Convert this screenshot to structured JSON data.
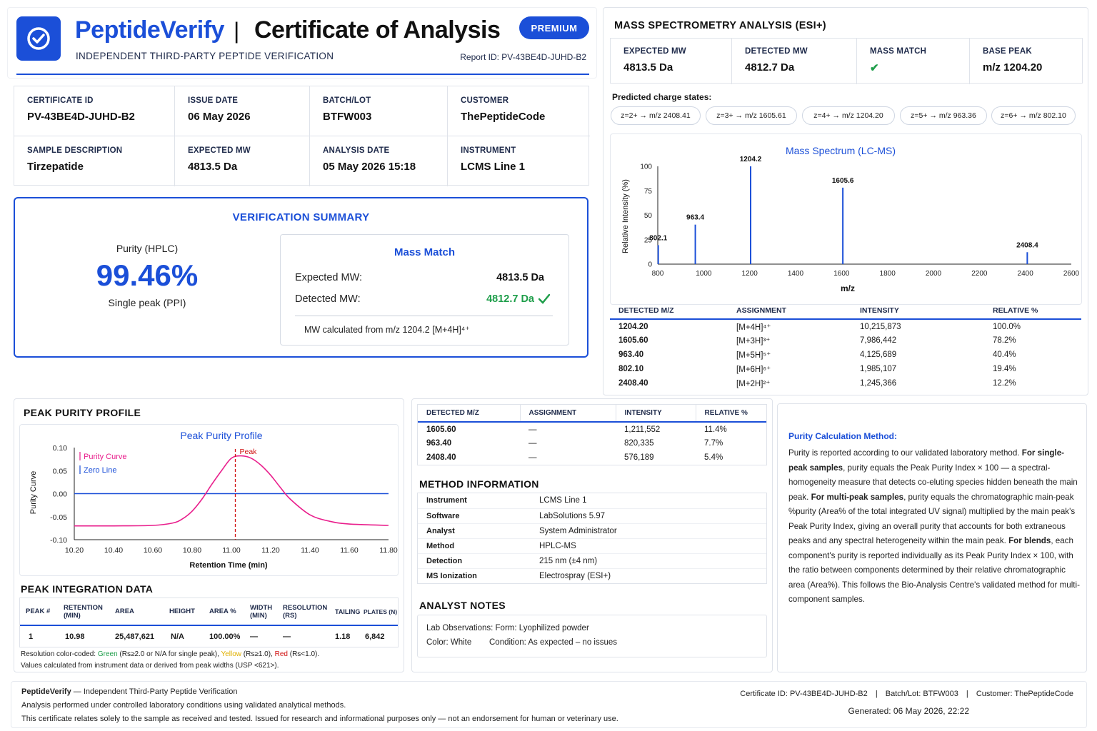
{
  "header": {
    "brand": "PeptideVerify",
    "divider": "|",
    "title": "Certificate of Analysis",
    "subtitle": "INDEPENDENT THIRD-PARTY PEPTIDE VERIFICATION",
    "badge": "PREMIUM",
    "report_id": "Report ID: PV-43BE4D-JUHD-B2"
  },
  "info": [
    {
      "label": "CERTIFICATE ID",
      "value": "PV-43BE4D-JUHD-B2"
    },
    {
      "label": "ISSUE DATE",
      "value": "06 May 2026"
    },
    {
      "label": "BATCH/LOT",
      "value": "BTFW003"
    },
    {
      "label": "CUSTOMER",
      "value": "ThePeptideCode"
    },
    {
      "label": "SAMPLE DESCRIPTION",
      "value": "Tirzepatide"
    },
    {
      "label": "EXPECTED MW",
      "value": "4813.5 Da"
    },
    {
      "label": "ANALYSIS DATE",
      "value": "05 May 2026 15:18"
    },
    {
      "label": "INSTRUMENT",
      "value": "LCMS Line 1"
    }
  ],
  "summary": {
    "title": "VERIFICATION SUMMARY",
    "purity_label": "Purity (HPLC)",
    "purity_value": "99.46%",
    "purity_note": "Single peak (PPI)",
    "mass_match_title": "Mass Match",
    "expected_label": "Expected MW:",
    "expected_value": "4813.5 Da",
    "detected_label": "Detected MW:",
    "detected_value": "4812.7 Da",
    "calc_note": "MW calculated from m/z 1204.2 [M+4H]⁴⁺"
  },
  "ms": {
    "title": "MASS SPECTROMETRY ANALYSIS (ESI+)",
    "stats": [
      {
        "label": "EXPECTED MW",
        "value": "4813.5 Da"
      },
      {
        "label": "DETECTED MW",
        "value": "4812.7 Da"
      },
      {
        "label": "MASS MATCH",
        "value": "✔"
      },
      {
        "label": "BASE PEAK",
        "value": "m/z 1204.20"
      }
    ],
    "charge_label": "Predicted charge states:",
    "charge_states": [
      "z=2+ → m/z 2408.41",
      "z=3+ → m/z 1605.61",
      "z=4+ → m/z 1204.20",
      "z=5+ → m/z 963.36",
      "z=6+ → m/z 802.10"
    ],
    "table_headers": [
      "DETECTED M/Z",
      "ASSIGNMENT",
      "INTENSITY",
      "RELATIVE %"
    ],
    "table_rows": [
      [
        "1204.20",
        "[M+4H]⁴⁺",
        "10,215,873",
        "100.0%"
      ],
      [
        "1605.60",
        "[M+3H]³⁺",
        "7,986,442",
        "78.2%"
      ],
      [
        "963.40",
        "[M+5H]⁵⁺",
        "4,125,689",
        "40.4%"
      ],
      [
        "802.10",
        "[M+6H]⁶⁺",
        "1,985,107",
        "19.4%"
      ],
      [
        "2408.40",
        "[M+2H]²⁺",
        "1,245,366",
        "12.2%"
      ]
    ]
  },
  "chart_data": [
    {
      "type": "bar",
      "title": "Mass Spectrum (LC-MS)",
      "xlabel": "m/z",
      "ylabel": "Relative Intensity (%)",
      "xlim": [
        800,
        2600
      ],
      "ylim": [
        0,
        100
      ],
      "xticks": [
        800,
        1000,
        1200,
        1400,
        1600,
        1800,
        2000,
        2200,
        2400,
        2600
      ],
      "yticks": [
        0,
        25,
        50,
        75,
        100
      ],
      "x": [
        802.1,
        963.4,
        1204.2,
        1605.6,
        2408.4
      ],
      "values": [
        19.4,
        40.4,
        100,
        78.2,
        12.2
      ],
      "labels": [
        "802.1",
        "963.4",
        "1204.2",
        "1605.6",
        "2408.4"
      ],
      "color": "#1b4fd8"
    },
    {
      "type": "line",
      "title": "Peak Purity Profile",
      "xlabel": "Retention Time (min)",
      "ylabel": "Purity Curve",
      "xlim": [
        10.2,
        11.8
      ],
      "ylim": [
        -0.1,
        0.1
      ],
      "xticks": [
        "10.20",
        "10.40",
        "10.60",
        "10.80",
        "11.00",
        "11.20",
        "11.40",
        "11.60",
        "11.80"
      ],
      "yticks": [
        "0.10",
        "0.05",
        "0.00",
        "-0.05",
        "-0.10"
      ],
      "series": [
        {
          "name": "Purity Curve",
          "color": "#e91e8c",
          "x": [
            10.2,
            10.4,
            10.6,
            10.7,
            10.75,
            10.8,
            10.85,
            10.9,
            10.95,
            11.0,
            11.05,
            11.1,
            11.15,
            11.2,
            11.25,
            11.3,
            11.4,
            11.5,
            11.6,
            11.8
          ],
          "y": [
            -0.07,
            -0.07,
            -0.069,
            -0.064,
            -0.055,
            -0.038,
            -0.012,
            0.02,
            0.05,
            0.077,
            0.082,
            0.077,
            0.062,
            0.04,
            0.013,
            -0.012,
            -0.046,
            -0.06,
            -0.066,
            -0.069
          ]
        },
        {
          "name": "Zero Line",
          "color": "#1b4fd8",
          "x": [
            10.2,
            11.8
          ],
          "y": [
            0,
            0
          ]
        }
      ],
      "annotations": [
        {
          "text": "Peak",
          "x": 11.02,
          "color": "#d01010"
        }
      ]
    }
  ],
  "peak_profile": {
    "section_title": "PEAK PURITY PROFILE"
  },
  "integration": {
    "title": "PEAK INTEGRATION DATA",
    "headers": [
      "PEAK #",
      "RETENTION (MIN)",
      "AREA",
      "HEIGHT",
      "AREA %",
      "WIDTH (MIN)",
      "RESOLUTION (RS)",
      "TAILING",
      "PLATES (N)"
    ],
    "row": [
      "1",
      "10.98",
      "25,487,621",
      "N/A",
      "100.00%",
      "—",
      "—",
      "1.18",
      "6,842"
    ],
    "note1_prefix": "Resolution color-coded: ",
    "note1_green": "Green",
    "note1_green_rule": " (Rs≥2.0 or N/A for single peak), ",
    "note1_yellow": "Yellow",
    "note1_yellow_rule": " (Rs≥1.0), ",
    "note1_red": "Red",
    "note1_red_rule": " (Rs<1.0).",
    "note2": "Values calculated from instrument data or derived from peak widths (USP <621>)."
  },
  "extra_table": {
    "headers": [
      "DETECTED M/Z",
      "ASSIGNMENT",
      "INTENSITY",
      "RELATIVE %"
    ],
    "rows": [
      [
        "1605.60",
        "—",
        "1,211,552",
        "11.4%"
      ],
      [
        "963.40",
        "—",
        "820,335",
        "7.7%"
      ],
      [
        "2408.40",
        "—",
        "576,189",
        "5.4%"
      ]
    ]
  },
  "method": {
    "title": "METHOD INFORMATION",
    "rows": [
      [
        "Instrument",
        "LCMS Line 1"
      ],
      [
        "Software",
        "LabSolutions 5.97"
      ],
      [
        "Analyst",
        "System Administrator"
      ],
      [
        "Method",
        "HPLC-MS"
      ],
      [
        "Detection",
        "215 nm (±4 nm)"
      ],
      [
        "MS Ionization",
        "Electrospray (ESI+)"
      ]
    ]
  },
  "notes": {
    "title": "ANALYST NOTES",
    "line1": "Lab Observations: Form: Lyophilized powder",
    "color": "Color: White",
    "condition": "Condition: As expected – no issues"
  },
  "purity_method": {
    "title": "Purity Calculation Method:",
    "p1": "Purity is reported according to our validated laboratory method.",
    "b1": "For single-peak samples",
    "t1": ", purity equals the Peak Purity Index × 100 — a spectral-homogeneity measure that detects co-eluting species hidden beneath the main peak. ",
    "b2": "For multi-peak samples",
    "t2": ", purity equals the chromatographic main-peak %purity (Area% of the total integrated UV signal) multiplied by the main peak's Peak Purity Index, giving an overall purity that accounts for both extraneous peaks and any spectral heterogeneity within the main peak. ",
    "b3": "For blends",
    "t3": ", each component's purity is reported individually as its Peak Purity Index × 100, with the ratio between components determined by their relative chromatographic area (Area%). This follows the Bio-Analysis Centre's validated method for multi-component samples."
  },
  "footer": {
    "brand": "PeptideVerify",
    "tagline": " — Independent Third-Party Peptide Verification",
    "line2": "Analysis performed under controlled laboratory conditions using validated analytical methods.",
    "line3": "This certificate relates solely to the sample as received and tested. Issued for research and informational purposes only — not an endorsement for human or veterinary use.",
    "cert": "Certificate ID: PV-43BE4D-JUHD-B2",
    "batch": "Batch/Lot: BTFW003",
    "customer": "Customer: ThePeptideCode",
    "sep": "|",
    "generated": "Generated: 06 May 2026, 22:22"
  },
  "colors": {
    "accent": "#1b4fd8",
    "success": "#1e9e4a",
    "pink": "#e91e8c",
    "red": "#d01010"
  }
}
